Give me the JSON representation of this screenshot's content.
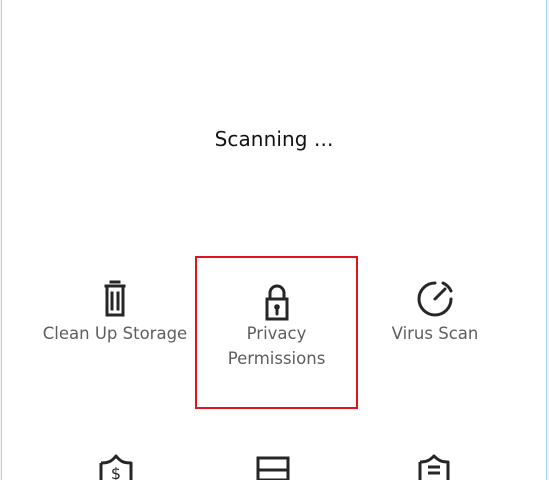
{
  "status": {
    "message": "Scanning ..."
  },
  "tools": {
    "cleanup": {
      "label": "Clean Up Storage",
      "icon": "trash-icon"
    },
    "privacy": {
      "label_line1": "Privacy",
      "label_line2": "Permissions",
      "icon": "lock-icon",
      "highlight_color": "#e0141d"
    },
    "virus": {
      "label": "Virus Scan",
      "icon": "gauge-icon"
    }
  },
  "partial_row": {
    "icons": [
      "shield-dollar-icon",
      "screen-icon",
      "document-shield-icon"
    ]
  },
  "colors": {
    "card_outline": "#a7d5f3",
    "text": "#121212",
    "label": "#5e5e5e",
    "highlight": "#e0141d"
  }
}
